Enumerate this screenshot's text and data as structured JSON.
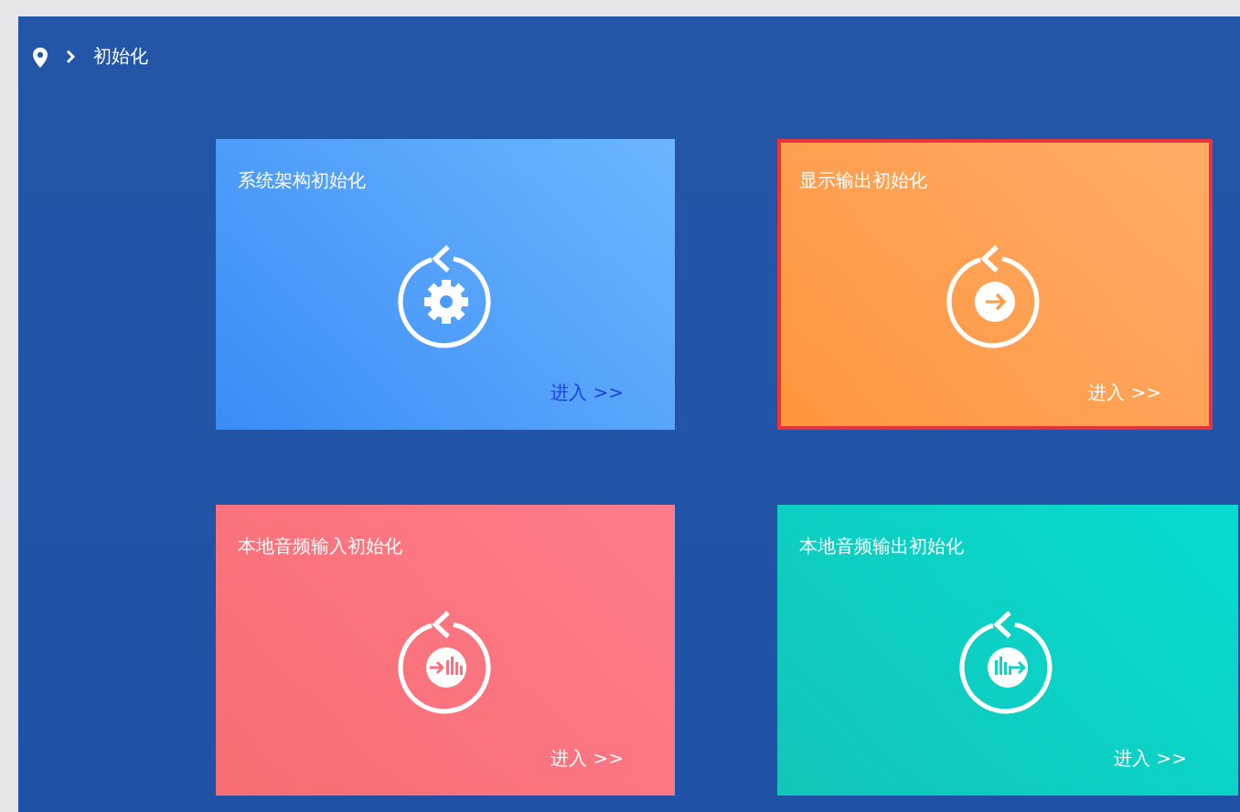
{
  "breadcrumb": {
    "items": [
      "初始化"
    ]
  },
  "cards": [
    {
      "title": "系统架构初始化",
      "kind": "gear",
      "link": "进入 >>",
      "selected": false,
      "hovered": true,
      "color": "#4a9cf5"
    },
    {
      "title": "显示输出初始化",
      "kind": "arrow",
      "link": "进入 >>",
      "selected": true,
      "hovered": false,
      "color": "#ff9a45"
    },
    {
      "title": "本地音频输入初始化",
      "kind": "audio-in",
      "link": "进入 >>",
      "selected": false,
      "hovered": false,
      "color": "#f8717c"
    },
    {
      "title": "本地音频输出初始化",
      "kind": "audio-out",
      "link": "进入 >>",
      "selected": false,
      "hovered": false,
      "color": "#12d1c6"
    }
  ]
}
